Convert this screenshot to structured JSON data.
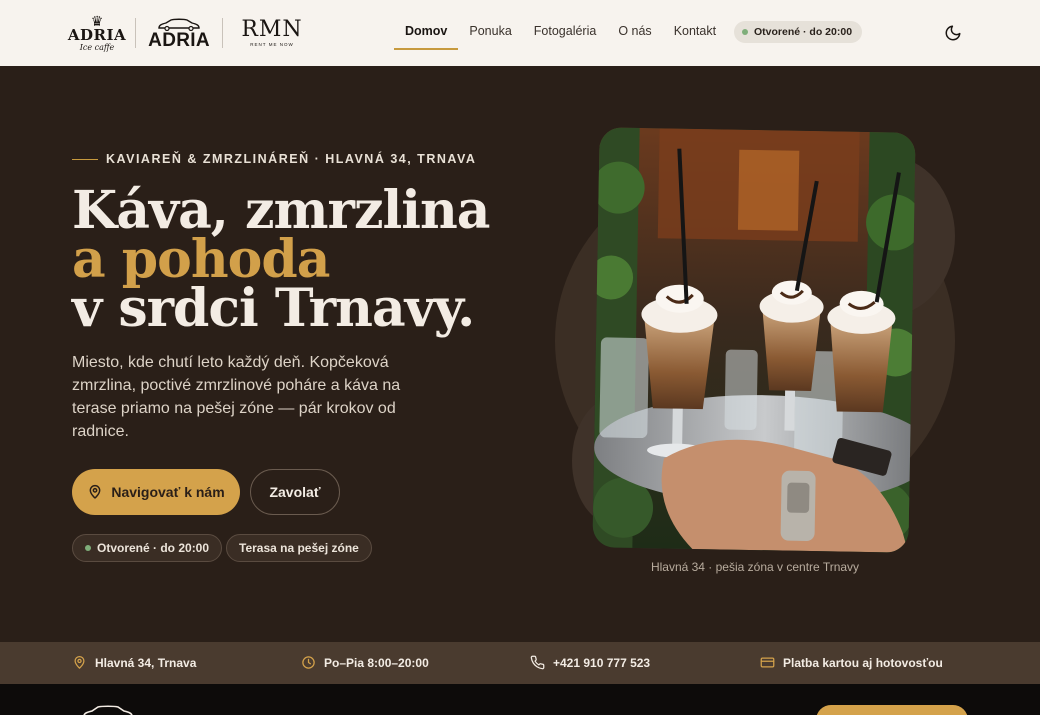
{
  "header": {
    "logos": [
      {
        "name": "adria-ice-caffe-logo",
        "word": "ADRIA",
        "sub": "Ice caffe"
      },
      {
        "name": "adria-car-logo",
        "word": "ADRIA"
      },
      {
        "name": "rmn-logo",
        "word": "RMN",
        "sub": "RENT ME NOW"
      }
    ],
    "nav": [
      {
        "label": "Domov",
        "active": true
      },
      {
        "label": "Ponuka",
        "active": false
      },
      {
        "label": "Fotogaléria",
        "active": false
      },
      {
        "label": "O nás",
        "active": false
      },
      {
        "label": "Kontakt",
        "active": false
      }
    ],
    "status": "Otvorené · do 20:00",
    "theme_icon": "moon-icon"
  },
  "hero": {
    "eyebrow": "KAVIAREŇ & ZMRZLINÁREŇ · HLAVNÁ 34, TRNAVA",
    "title_line1": "Káva, zmrzlina",
    "title_line2": "a pohoda",
    "title_line3": "v srdci Trnavy.",
    "lead": "Miesto, kde chutí leto každý deň. Kopčeková zmrzlina, poctivé zmrzlinové poháre a káva na terase priamo na pešej zóne — pár krokov od radnice.",
    "primary_button": "Navigovať k nám",
    "secondary_button": "Zavolať",
    "chips": [
      "Otvorené · do 20:00",
      "Terasa na pešej zóne"
    ],
    "photo_caption": "Hlavná 34 · pešia zóna v centre Trnavy"
  },
  "infobar": {
    "items": [
      {
        "icon": "pin-icon",
        "label": "Hlavná 34, Trnava"
      },
      {
        "icon": "clock-icon",
        "label": "Po–Pia 8:00–20:00"
      },
      {
        "icon": "phone-icon",
        "label": "+421 910 777 523"
      },
      {
        "icon": "card-icon",
        "label": "Platba kartou aj hotovosťou"
      }
    ]
  },
  "colors": {
    "accent": "#d4a24b",
    "hero_bg": "#2a1f18",
    "header_bg": "#f7f3ee",
    "status_dot": "#7fae7a"
  }
}
